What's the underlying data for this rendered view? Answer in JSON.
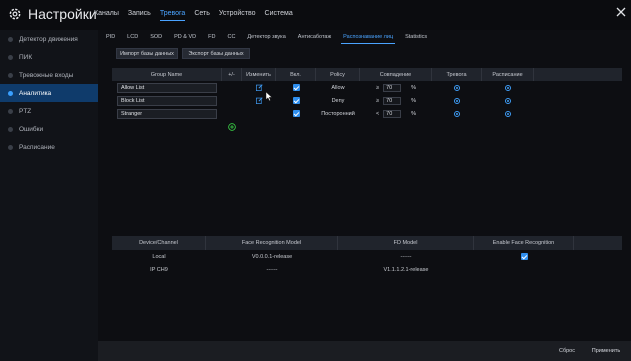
{
  "app": {
    "title": "Настройки"
  },
  "main_nav": [
    "Каналы",
    "Запись",
    "Тревога",
    "Сеть",
    "Устройство",
    "Система"
  ],
  "main_nav_active": 2,
  "sidebar": [
    {
      "label": "Детектор движения",
      "active": false
    },
    {
      "label": "ПИК",
      "active": false
    },
    {
      "label": "Тревожные входы",
      "active": false
    },
    {
      "label": "Аналитика",
      "active": true
    },
    {
      "label": "PTZ",
      "active": false
    },
    {
      "label": "Ошибки",
      "active": false
    },
    {
      "label": "Расписание",
      "active": false
    }
  ],
  "sub_tabs": [
    "PID",
    "LCD",
    "SOD",
    "PD & VD",
    "FD",
    "CC",
    "Детектор звука",
    "Антисаботаж",
    "Распознавание лиц",
    "Statistics"
  ],
  "sub_tabs_active": 8,
  "buttons": {
    "import_db": "Импорт базы данных",
    "export_db": "Экспорт базы данных",
    "reset": "Сброс",
    "apply": "Применить"
  },
  "group_table": {
    "headers": [
      "Group Name",
      "+/-",
      "Изменить",
      "Вкл.",
      "Policy",
      "Совпадение",
      "Тревога",
      "Расписание"
    ],
    "rows": [
      {
        "name": "Allow List",
        "editable": true,
        "enabled": true,
        "policy": "Allow",
        "op": "≥",
        "match": "70",
        "unit": "%"
      },
      {
        "name": "Block List",
        "editable": true,
        "enabled": true,
        "policy": "Deny",
        "op": "≥",
        "match": "70",
        "unit": "%"
      },
      {
        "name": "Stranger",
        "editable": false,
        "enabled": true,
        "policy": "Посторонний",
        "op": "<",
        "match": "70",
        "unit": "%"
      }
    ]
  },
  "model_table": {
    "headers": [
      "Device/Channel",
      "Face Recognition Model",
      "FD Model",
      "Enable Face Recognition"
    ],
    "rows": [
      {
        "device": "Local",
        "fr_model": "V0.0.0.1-release",
        "fd_model": "------",
        "enable": true
      },
      {
        "device": "IP CH9",
        "fr_model": "------",
        "fd_model": "V1.1.1.2.1-release",
        "enable": false
      }
    ]
  },
  "colors": {
    "accent": "#3aa0ff",
    "active_side": "#0f3b6b",
    "add_icon": "#3ddc4a"
  }
}
